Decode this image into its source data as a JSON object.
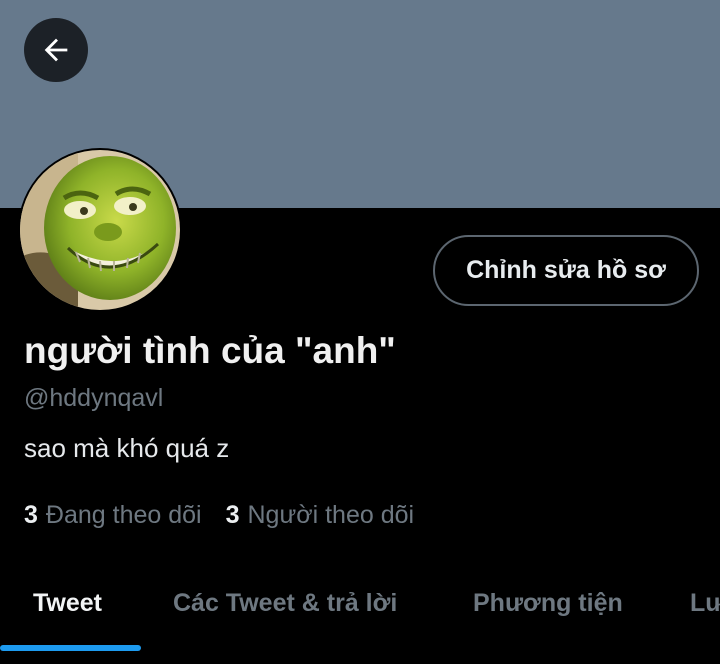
{
  "profile": {
    "display_name": "người tình của \"anh\"",
    "handle": "@hddynqavl",
    "bio": "sao mà khó quá z",
    "following_count": "3",
    "following_label": "Đang theo dõi",
    "followers_count": "3",
    "followers_label": "Người theo dõi",
    "edit_profile_label": "Chỉnh sửa hồ sơ"
  },
  "tabs": [
    {
      "label": "Tweet",
      "active": true
    },
    {
      "label": "Các Tweet & trả lời",
      "active": false
    },
    {
      "label": "Phương tiện",
      "active": false
    },
    {
      "label": "Lư",
      "active": false
    }
  ],
  "colors": {
    "banner": "#66798c",
    "accent": "#1d9bf0",
    "background": "#000000",
    "muted_text": "#6e7881"
  },
  "icons": {
    "back": "arrow-left-icon",
    "avatar": "avatar"
  }
}
